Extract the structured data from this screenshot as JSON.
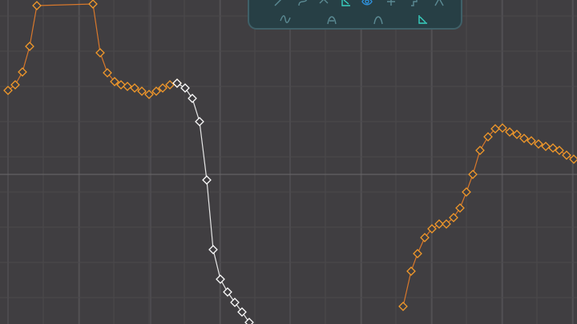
{
  "editor": {
    "colors": {
      "background": "#403e41",
      "grid_minor": "#4b494c",
      "grid_major": "#59575a",
      "axis": "#6a686b",
      "curve_orange": "#d8782c",
      "key_orange": "#f39a2a",
      "curve_white": "#e6e6e6",
      "key_white": "#ffffff",
      "toolbar_bg": "#273f45",
      "toolbar_border": "#3f6068",
      "icon_dim": "#5b8a93",
      "icon_active": "#38d0c0",
      "icon_highlight": "#2f8fd8"
    }
  },
  "toolbar": {
    "top_row": [
      {
        "icon": "linear-interp-icon",
        "active": false
      },
      {
        "icon": "bezier-interp-icon",
        "active": false
      },
      {
        "icon": "break-tangent-icon",
        "active": false
      },
      {
        "icon": "smooth-tangent-icon",
        "active": true
      },
      {
        "icon": "eye-visibility-icon",
        "active": true
      },
      {
        "icon": "flat-tangent-icon",
        "active": false
      },
      {
        "icon": "stepped-interp-icon",
        "active": false
      },
      {
        "icon": "auto-tangent-icon",
        "active": false
      }
    ],
    "bottom_row": [
      {
        "icon": "ease-in-out-curve-icon",
        "active": false
      },
      {
        "icon": "ease-in-curve-icon",
        "active": false
      },
      {
        "icon": "ease-out-curve-icon",
        "active": false
      },
      {
        "icon": "weighted-tangent-icon",
        "active": true
      }
    ]
  },
  "curves": [
    {
      "name": "orange-curve-left",
      "color_key": "orange",
      "keys": [
        [
          10,
          113
        ],
        [
          19,
          106
        ],
        [
          28,
          90
        ],
        [
          37,
          58
        ],
        [
          46,
          7
        ],
        [
          116,
          5
        ],
        [
          125,
          66
        ],
        [
          134,
          91
        ],
        [
          143,
          102
        ],
        [
          151,
          106
        ],
        [
          159,
          108
        ],
        [
          168,
          110
        ],
        [
          177,
          114
        ],
        [
          186,
          118
        ],
        [
          195,
          114
        ],
        [
          203,
          110
        ],
        [
          212,
          106
        ],
        [
          221,
          104
        ]
      ]
    },
    {
      "name": "white-curve",
      "color_key": "white",
      "keys": [
        [
          221,
          104
        ],
        [
          231,
          110
        ],
        [
          240,
          123
        ],
        [
          249,
          152
        ],
        [
          258,
          225
        ],
        [
          266,
          312
        ],
        [
          275,
          349
        ],
        [
          284,
          365
        ],
        [
          293,
          378
        ],
        [
          302,
          390
        ],
        [
          311,
          403
        ]
      ]
    },
    {
      "name": "orange-curve-right",
      "color_key": "orange",
      "keys": [
        [
          503,
          383
        ],
        [
          513,
          339
        ],
        [
          521,
          317
        ],
        [
          530,
          297
        ],
        [
          539,
          286
        ],
        [
          548,
          280
        ],
        [
          557,
          280
        ],
        [
          566,
          272
        ],
        [
          574,
          260
        ],
        [
          582,
          240
        ],
        [
          590,
          218
        ],
        [
          599,
          188
        ],
        [
          609,
          171
        ],
        [
          618,
          161
        ],
        [
          627,
          160
        ],
        [
          636,
          165
        ],
        [
          645,
          168
        ],
        [
          654,
          173
        ],
        [
          663,
          176
        ],
        [
          672,
          180
        ],
        [
          681,
          183
        ],
        [
          690,
          185
        ],
        [
          698,
          188
        ],
        [
          707,
          194
        ],
        [
          716,
          199
        ]
      ]
    }
  ]
}
